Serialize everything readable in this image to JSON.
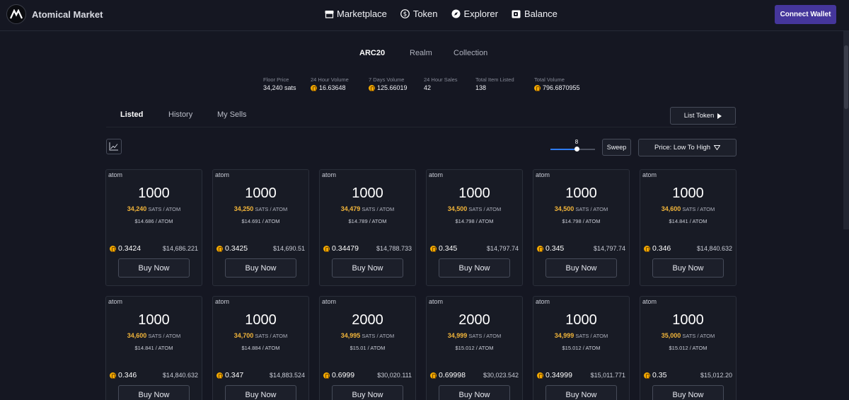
{
  "app": {
    "title": "Atomical Market"
  },
  "nav": [
    {
      "label": "Marketplace",
      "icon": "store-icon"
    },
    {
      "label": "Token",
      "icon": "dollar-coin-icon"
    },
    {
      "label": "Explorer",
      "icon": "compass-icon"
    },
    {
      "label": "Balance",
      "icon": "wallet-icon"
    }
  ],
  "connect_wallet": "Connect Wallet",
  "category_tabs": [
    {
      "label": "ARC20",
      "active": true
    },
    {
      "label": "Realm",
      "active": false
    },
    {
      "label": "Collection",
      "active": false
    }
  ],
  "stats": [
    {
      "label": "Floor Price",
      "value": "34,240 sats",
      "coin": false
    },
    {
      "label": "24 Hour Volume",
      "value": "16.63648",
      "coin": true
    },
    {
      "label": "7 Days Volume",
      "value": "125.66019",
      "coin": true
    },
    {
      "label": "24 Hour Sales",
      "value": "42",
      "coin": false
    },
    {
      "label": "Total Item Listed",
      "value": "138",
      "coin": false
    },
    {
      "label": "Total Volume",
      "value": "796.6870955",
      "coin": true
    }
  ],
  "listing_tabs": [
    {
      "label": "Listed",
      "active": true
    },
    {
      "label": "History",
      "active": false
    },
    {
      "label": "My Sells",
      "active": false
    }
  ],
  "list_token_label": "List Token",
  "sweep": {
    "count": "8",
    "level": 0.6,
    "label": "Sweep"
  },
  "sort_label": "Price: Low To High",
  "card_common": {
    "buy_label": "Buy Now",
    "sats_unit": "SATS / ATOM",
    "usd_unit": "/ ATOM"
  },
  "cards": [
    {
      "tick": "atom",
      "amount": "1000",
      "sats": "34,240",
      "usd_per": "$14.686",
      "btc": "0.3424",
      "usd": "$14,686.221"
    },
    {
      "tick": "atom",
      "amount": "1000",
      "sats": "34,250",
      "usd_per": "$14.691",
      "btc": "0.3425",
      "usd": "$14,690.51"
    },
    {
      "tick": "atom",
      "amount": "1000",
      "sats": "34,479",
      "usd_per": "$14.789",
      "btc": "0.34479",
      "usd": "$14,788.733"
    },
    {
      "tick": "atom",
      "amount": "1000",
      "sats": "34,500",
      "usd_per": "$14.798",
      "btc": "0.345",
      "usd": "$14,797.74"
    },
    {
      "tick": "atom",
      "amount": "1000",
      "sats": "34,500",
      "usd_per": "$14.798",
      "btc": "0.345",
      "usd": "$14,797.74"
    },
    {
      "tick": "atom",
      "amount": "1000",
      "sats": "34,600",
      "usd_per": "$14.841",
      "btc": "0.346",
      "usd": "$14,840.632"
    },
    {
      "tick": "atom",
      "amount": "1000",
      "sats": "34,600",
      "usd_per": "$14.841",
      "btc": "0.346",
      "usd": "$14,840.632"
    },
    {
      "tick": "atom",
      "amount": "1000",
      "sats": "34,700",
      "usd_per": "$14.884",
      "btc": "0.347",
      "usd": "$14,883.524"
    },
    {
      "tick": "atom",
      "amount": "2000",
      "sats": "34,995",
      "usd_per": "$15.01",
      "btc": "0.6999",
      "usd": "$30,020.111"
    },
    {
      "tick": "atom",
      "amount": "2000",
      "sats": "34,999",
      "usd_per": "$15.012",
      "btc": "0.69998",
      "usd": "$30,023.542"
    },
    {
      "tick": "atom",
      "amount": "1000",
      "sats": "34,999",
      "usd_per": "$15.012",
      "btc": "0.34999",
      "usd": "$15,011.771"
    },
    {
      "tick": "atom",
      "amount": "1000",
      "sats": "35,000",
      "usd_per": "$15.012",
      "btc": "0.35",
      "usd": "$15,012.20"
    }
  ],
  "colors": {
    "accent": "#45369b",
    "gold": "#f2b53a",
    "slider": "#2e7bf0",
    "background": "#151722"
  }
}
